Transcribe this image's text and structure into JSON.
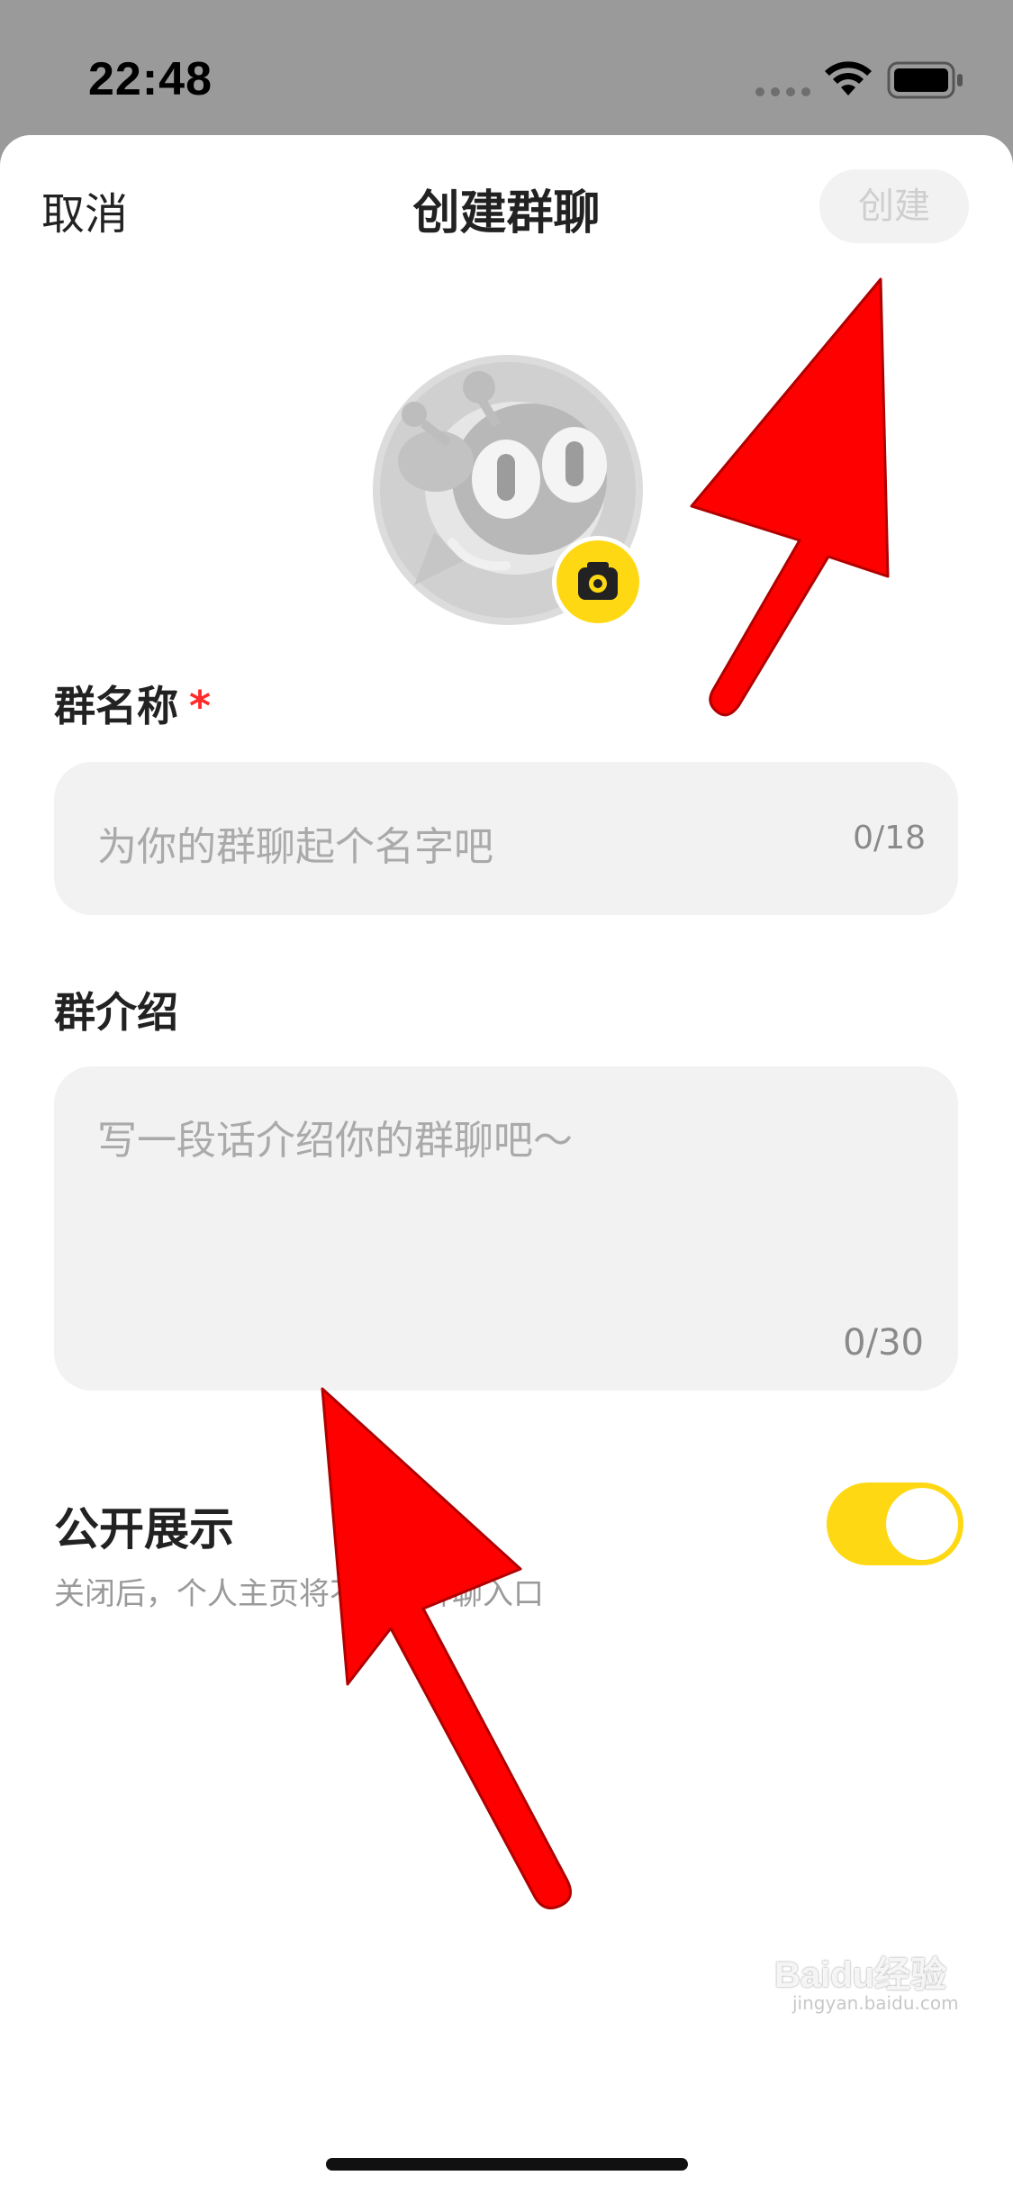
{
  "status_bar": {
    "time": "22:48",
    "icons": [
      "signal-dots-icon",
      "wifi-icon",
      "battery-icon"
    ]
  },
  "header": {
    "cancel_label": "取消",
    "title": "创建群聊",
    "create_label": "创建"
  },
  "avatar": {
    "icon": "default-group-avatar",
    "badge_icon": "camera-icon"
  },
  "group_name": {
    "label": "群名称",
    "required_mark": "*",
    "placeholder": "为你的群聊起个名字吧",
    "counter": "0/18"
  },
  "group_intro": {
    "label": "群介绍",
    "placeholder": "写一段话介绍你的群聊吧～",
    "counter": "0/30"
  },
  "public_display": {
    "label": "公开展示",
    "description": "关闭后，个人主页将不展示群聊入口",
    "enabled": true
  },
  "watermark": {
    "text": "Baidu经验",
    "sub": "jingyan.baidu.com"
  },
  "colors": {
    "accent_yellow": "#ffd814",
    "annotation_red": "#ff0000",
    "field_bg": "#f2f2f2"
  }
}
